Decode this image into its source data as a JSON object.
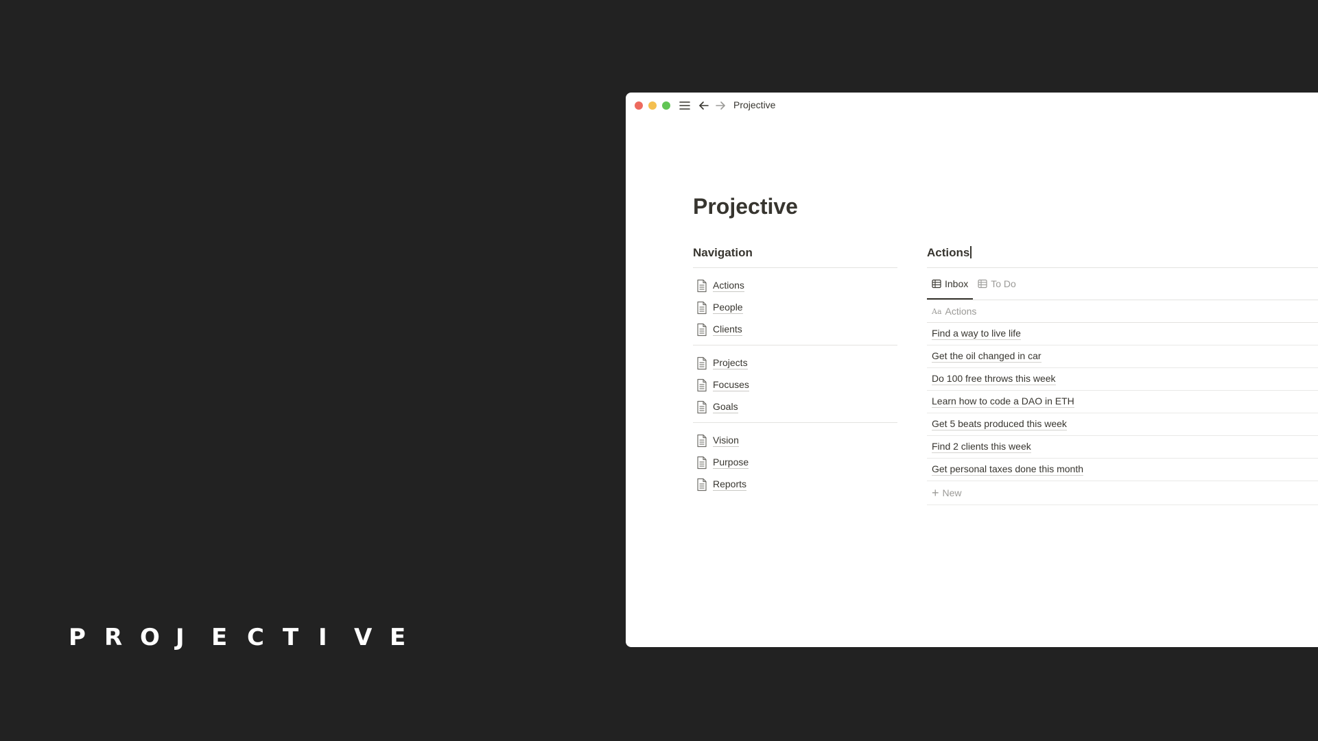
{
  "brand": {
    "letters": [
      "P",
      "R",
      "O",
      "J",
      "E",
      "C",
      "T",
      "I",
      "V",
      "E"
    ]
  },
  "window": {
    "breadcrumb": "Projective",
    "toolbar_icons": [
      "hamburger-menu-icon",
      "back-arrow-icon",
      "forward-arrow-icon"
    ],
    "traffic_light_colors": [
      "#ed6a5e",
      "#f4bf4f",
      "#61c554"
    ]
  },
  "page": {
    "title": "Projective"
  },
  "navigation": {
    "heading": "Navigation",
    "groups": [
      {
        "items": [
          {
            "label": "Actions"
          },
          {
            "label": "People"
          },
          {
            "label": "Clients"
          }
        ]
      },
      {
        "items": [
          {
            "label": "Projects"
          },
          {
            "label": "Focuses"
          },
          {
            "label": "Goals"
          }
        ]
      },
      {
        "items": [
          {
            "label": "Vision"
          },
          {
            "label": "Purpose"
          },
          {
            "label": "Reports"
          }
        ]
      }
    ]
  },
  "actions": {
    "heading": "Actions",
    "tabs": [
      {
        "label": "Inbox",
        "active": true
      },
      {
        "label": "To Do",
        "active": false
      }
    ],
    "column_header": "Actions",
    "rows": [
      "Find a way to live life",
      "Get the oil changed in car",
      "Do 100 free throws this week",
      "Learn how to code a DAO in ETH",
      "Get 5 beats produced this week",
      "Find 2 clients this week",
      "Get personal taxes done this month"
    ],
    "new_label": "New"
  }
}
